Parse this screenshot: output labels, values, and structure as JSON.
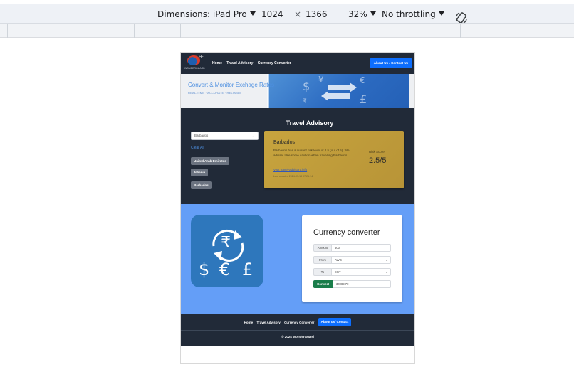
{
  "devtools": {
    "dimensions_label": "Dimensions: iPad Pro",
    "width": "1024",
    "times": "×",
    "height": "1366",
    "zoom": "32%",
    "throttling": "No throttling",
    "rotate_icon": "rotate-icon"
  },
  "site": {
    "nav": {
      "logo_text": "WONDERGUARD",
      "links": [
        "Home",
        "Travel Advisory",
        "Currency Converter"
      ],
      "cta": "About Us / Contact Us"
    },
    "banner": {
      "title": "Convert & Monitor Exchage Rates",
      "subtitle": "REAL-TIME · ACCURATE · RELIABLE",
      "image_symbols": [
        "$",
        "¥",
        "€",
        "£",
        "₹"
      ]
    },
    "advisory": {
      "title": "Travel Advisory",
      "select_value": "Barbados",
      "clear_label": "Clear All",
      "chips": [
        "United Arab Emirates",
        "Albania",
        "Barbados"
      ],
      "card": {
        "country": "Barbados",
        "text": "Barbados has a current risk level of 2.5 (out of 5). We advise: Use some caution when travelling Barbados.",
        "link": "Visit travel-advisory.info",
        "updated": "Last updated 2024-07-18 07:21:14",
        "risk_label": "Risk Score",
        "risk_score": "2.5/5",
        "color": "#c7a43e"
      }
    },
    "converter": {
      "icon_symbols": [
        "₹",
        "$",
        "€",
        "£"
      ],
      "title": "Currency converter",
      "amount_label": "Amount",
      "amount_value": "500",
      "from_label": "From",
      "from_value": "AWG",
      "to_label": "To",
      "to_value": "EGT",
      "convert_label": "Convert",
      "result_value": "30089.70"
    },
    "footer": {
      "links": [
        "Home",
        "Travel Advisory",
        "Currency Converter"
      ],
      "cta": "About us/ Contact",
      "copyright": "© 2024 WonderGuard"
    },
    "colors": {
      "navbar": "#212a38",
      "primary": "#0d6efd",
      "converter_bg": "#649ef7",
      "convert_button": "#1a7d4a"
    }
  }
}
